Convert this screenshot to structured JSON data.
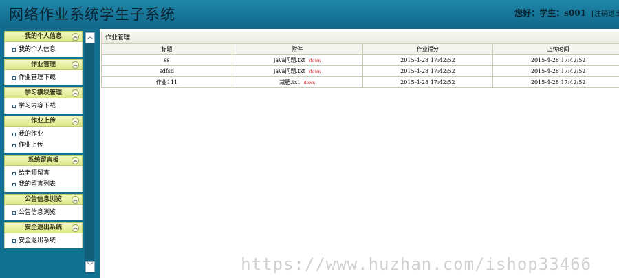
{
  "header": {
    "title": "网络作业系统学生子系统",
    "greeting": "您好：学生：s001",
    "logout": "[注销退出"
  },
  "menu": [
    {
      "title": "我的个人信息",
      "items": [
        "我的个人信息"
      ]
    },
    {
      "title": "作业管理",
      "items": [
        "作业管理下载"
      ]
    },
    {
      "title": "学习模块管理",
      "items": [
        "学习内容下载"
      ]
    },
    {
      "title": "作业上传",
      "items": [
        "我的作业",
        "作业上传"
      ]
    },
    {
      "title": "系统留言板",
      "items": [
        "给老师留言",
        "我的留言列表"
      ]
    },
    {
      "title": "公告信息浏览",
      "items": [
        "公告信息浏览"
      ]
    },
    {
      "title": "安全退出系统",
      "items": [
        "安全退出系统"
      ]
    }
  ],
  "panel": {
    "title": "作业管理",
    "columns": [
      "标题",
      "附件",
      "作业得分",
      "上传时间"
    ],
    "rows": [
      {
        "title": "ss",
        "attachment": "java问题.txt",
        "link": "down",
        "score": "2015-4-28 17:42:52",
        "time": "2015-4-28 17:42:52"
      },
      {
        "title": "sdfsd",
        "attachment": "java问题.txt",
        "link": "down",
        "score": "2015-4-28 17:42:52",
        "time": "2015-4-28 17:42:52"
      },
      {
        "title": "作业111",
        "attachment": "减肥.txt",
        "link": "down",
        "score": "2015-4-28 17:42:52",
        "time": "2015-4-28 17:42:52"
      }
    ]
  },
  "watermark": "https://www.huzhan.com/ishop33466"
}
